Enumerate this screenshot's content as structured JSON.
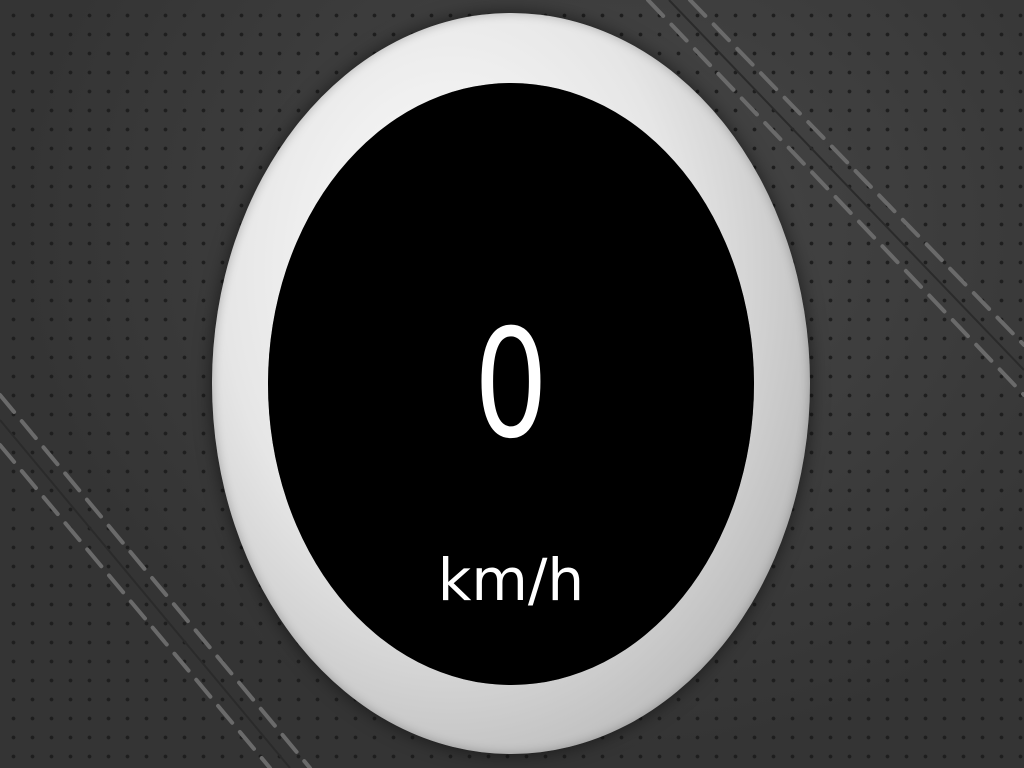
{
  "speedometer": {
    "speed": "0",
    "unit": "km/h"
  },
  "colors": {
    "background": "#3b3b3b",
    "bezel": "#e6e6e6",
    "face": "#000000",
    "text": "#ffffff"
  }
}
